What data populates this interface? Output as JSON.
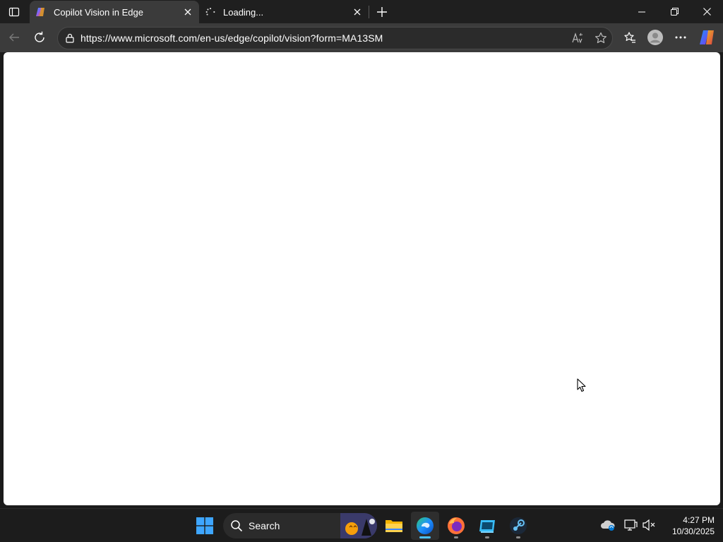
{
  "browser": {
    "tabs": [
      {
        "title": "Copilot Vision in Edge",
        "active": true
      },
      {
        "title": "Loading...",
        "active": false
      }
    ],
    "address_bar": {
      "url": "https://www.microsoft.com/en-us/edge/copilot/vision?form=MA13SM"
    }
  },
  "icons": {
    "tab_actions": "tab-actions-icon",
    "copilot": "copilot-icon",
    "loading": "loading-spinner-icon",
    "close": "close-icon",
    "new_tab": "plus-icon",
    "minimize": "minimize-icon",
    "restore": "restore-icon",
    "back": "back-arrow-icon",
    "refresh": "refresh-icon",
    "site_info": "lock-icon",
    "read_aloud": "read-aloud-icon",
    "favorite": "star-icon",
    "favorites": "favorites-icon",
    "profile": "profile-icon",
    "more": "more-icon"
  },
  "taskbar": {
    "search_label": "Search",
    "apps": [
      "start",
      "search",
      "file-explorer",
      "edge",
      "firefox",
      "app",
      "steam"
    ],
    "clock": {
      "time": "4:27 PM",
      "date": "10/30/2025"
    }
  },
  "colors": {
    "accent": "#4cc2ff",
    "titlebar": "#1f1f1f",
    "toolbar": "#3b3b3b",
    "taskbar": "#1c1c1c"
  }
}
